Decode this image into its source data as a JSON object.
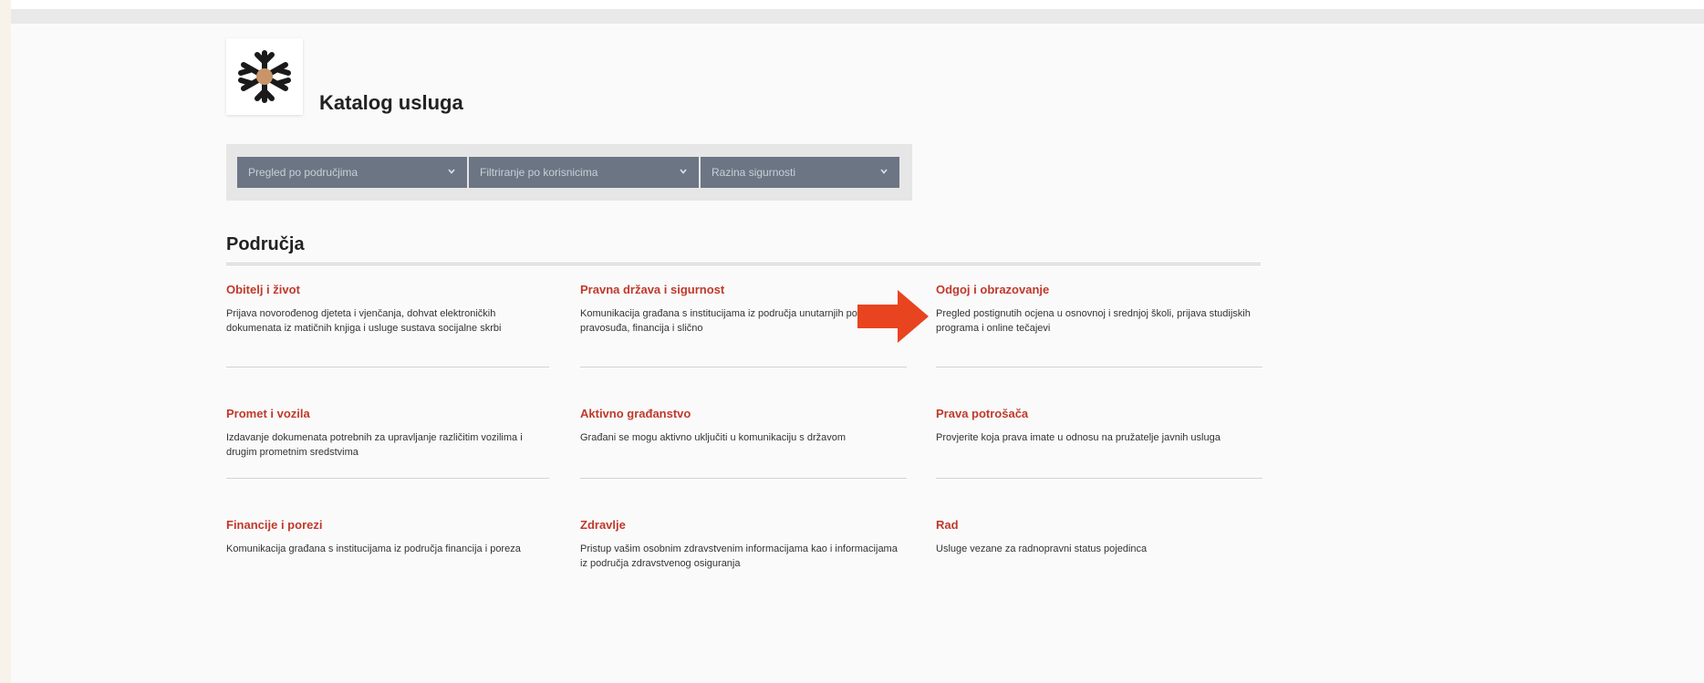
{
  "header": {
    "title": "Katalog usluga"
  },
  "filters": [
    {
      "label": "Pregled po područjima"
    },
    {
      "label": "Filtriranje po korisnicima"
    },
    {
      "label": "Razina sigurnosti"
    }
  ],
  "section": {
    "heading": "Područja"
  },
  "categories": [
    {
      "title": "Obitelj i život",
      "description": "Prijava novorođenog djeteta i vjenčanja, dohvat elektroničkih dokumenata iz matičnih knjiga i usluge sustava socijalne skrbi"
    },
    {
      "title": "Pravna država i sigurnost",
      "description": "Komunikacija građana s institucijama iz područja unutarnjih poslova, pravosuđa, financija i slično"
    },
    {
      "title": "Odgoj i obrazovanje",
      "description": "Pregled postignutih ocjena u osnovnoj i srednjoj školi, prijava studijskih programa i online tečajevi"
    },
    {
      "title": "Promet i vozila",
      "description": "Izdavanje dokumenata potrebnih za upravljanje različitim vozilima i drugim prometnim sredstvima"
    },
    {
      "title": "Aktivno građanstvo",
      "description": "Građani se mogu aktivno uključiti u komunikaciju s državom"
    },
    {
      "title": "Prava potrošača",
      "description": "Provjerite koja prava imate u odnosu na pružatelje javnih usluga"
    },
    {
      "title": "Financije i porezi",
      "description": "Komunikacija građana s institucijama iz područja financija i poreza"
    },
    {
      "title": "Zdravlje",
      "description": "Pristup vašim osobnim zdravstvenim informacijama kao i informacijama iz područja zdravstvenog osiguranja"
    },
    {
      "title": "Rad",
      "description": "Usluge vezane za radnopravni status pojedinca"
    }
  ],
  "colors": {
    "accent": "#c0392b",
    "filter_bg": "#6b7584",
    "arrow": "#e8441f"
  }
}
